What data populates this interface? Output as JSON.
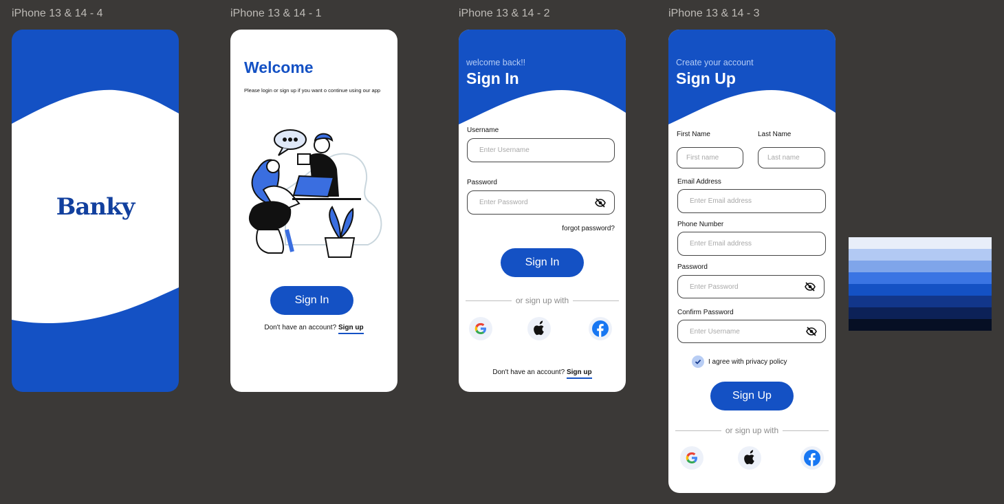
{
  "frames": {
    "splash": "iPhone 13 & 14 - 4",
    "welcome": "iPhone 13 & 14 - 1",
    "signin": "iPhone 13 & 14 - 2",
    "signup": "iPhone 13 & 14 - 3"
  },
  "splash": {
    "logo": "Banky"
  },
  "welcome": {
    "title": "Welcome",
    "subtitle": "Please login or sign up if you want o continue using our app",
    "button": "Sign In",
    "no_account": "Don't have an account?",
    "signup_link": "Sign up"
  },
  "signin": {
    "small": "welcome back!!",
    "title": "Sign In",
    "username_label": "Username",
    "username_placeholder": "Enter Username",
    "password_label": "Password",
    "password_placeholder": "Enter Password",
    "forgot": "forgot password?",
    "button": "Sign In",
    "divider": "or sign up with",
    "no_account": "Don't have an account?",
    "signup_link": "Sign up"
  },
  "signup": {
    "small": "Create your account",
    "title": "Sign Up",
    "first_label": "First Name",
    "first_placeholder": "First name",
    "last_label": "Last Name",
    "last_placeholder": "Last name",
    "email_label": "Email Address",
    "email_placeholder": "Enter Email address",
    "phone_label": "Phone Number",
    "phone_placeholder": "Enter Email address",
    "password_label": "Password",
    "password_placeholder": "Enter Password",
    "confirm_label": "Confirm Password",
    "confirm_placeholder": "Enter Username",
    "agree": "I agree with privacy  policy",
    "button": "Sign Up",
    "divider": "or sign up with"
  },
  "colors": {
    "primary": "#1451c4",
    "palette": [
      "#e8eef9",
      "#b2c9f3",
      "#7fa5ea",
      "#3a74e3",
      "#1451c4",
      "#12368a",
      "#0c2157",
      "#060f24"
    ]
  },
  "icons": [
    "google-icon",
    "apple-icon",
    "facebook-icon",
    "eye-off-icon",
    "check-icon"
  ]
}
